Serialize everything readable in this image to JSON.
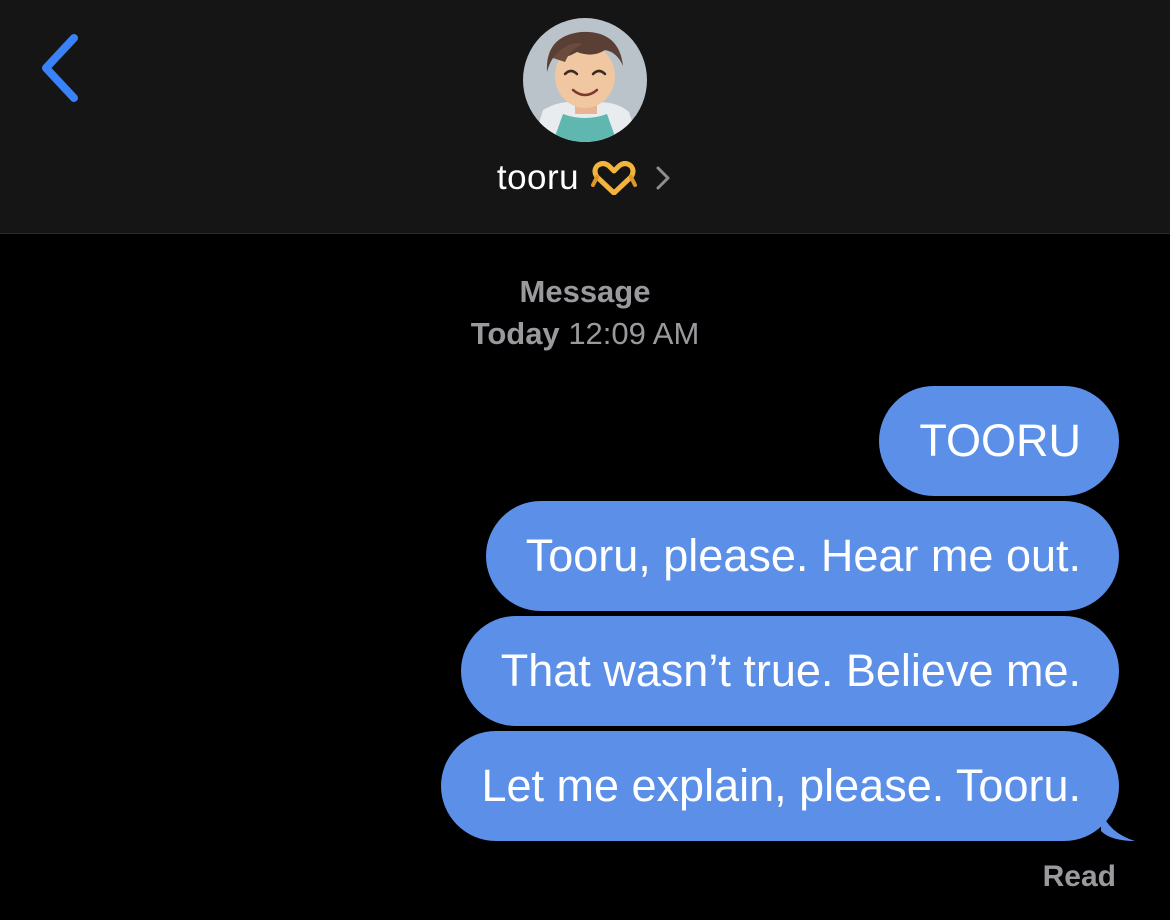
{
  "header": {
    "back_icon": "chevron-left-icon",
    "contact_name": "tooru",
    "contact_emoji_icon": "heart-hands-emoji",
    "details_icon": "chevron-right-icon",
    "accent_color": "#3a82f7"
  },
  "thread_meta": {
    "service": "Message",
    "day": "Today",
    "time": "12:09 AM"
  },
  "messages": [
    {
      "text": "TOORU",
      "sender": "me"
    },
    {
      "text": "Tooru, please. Hear me out.",
      "sender": "me"
    },
    {
      "text": "That wasn’t true. Believe me.",
      "sender": "me"
    },
    {
      "text": "Let me explain, please. Tooru.",
      "sender": "me"
    }
  ],
  "status": {
    "read_receipt": "Read"
  },
  "colors": {
    "bubble": "#5b8fe8",
    "header_bg": "#151515",
    "background": "#000000",
    "meta_text": "#9a9a9e"
  }
}
